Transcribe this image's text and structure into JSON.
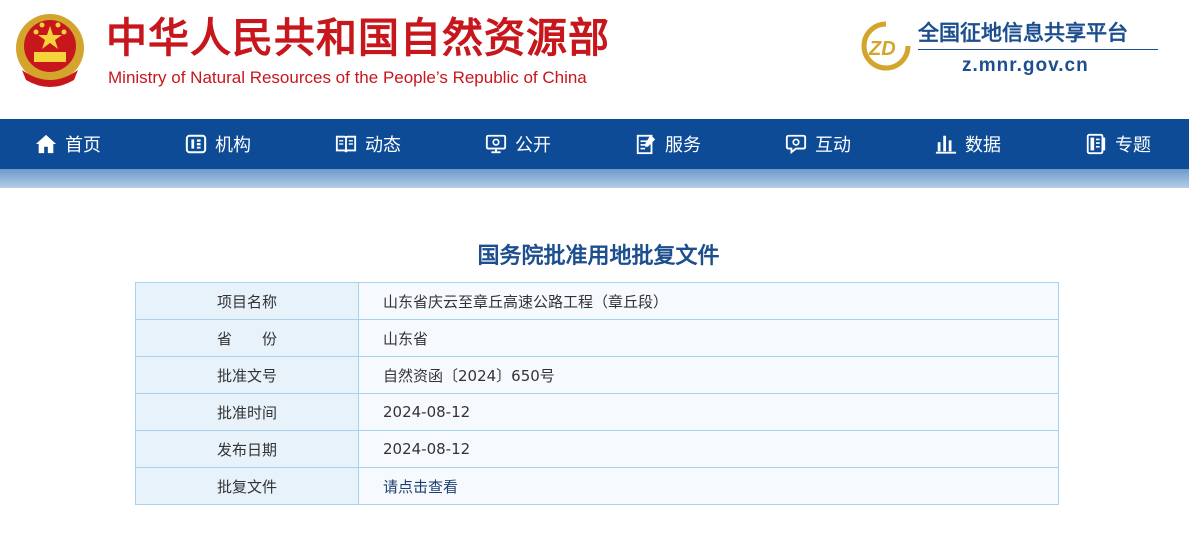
{
  "header": {
    "title_cn": "中华人民共和国自然资源部",
    "title_en": "Ministry of Natural Resources of the People’s Republic of China",
    "emblem_icon": "national-emblem-icon",
    "platform": {
      "logo_text": "ZD",
      "name": "全国征地信息共享平台",
      "url": "z.mnr.gov.cn"
    }
  },
  "nav": {
    "items": [
      {
        "label": "首页",
        "icon": "home-icon"
      },
      {
        "label": "机构",
        "icon": "organization-icon"
      },
      {
        "label": "动态",
        "icon": "book-icon"
      },
      {
        "label": "公开",
        "icon": "monitor-icon"
      },
      {
        "label": "服务",
        "icon": "edit-document-icon"
      },
      {
        "label": "互动",
        "icon": "chat-icon"
      },
      {
        "label": "数据",
        "icon": "bar-chart-icon"
      },
      {
        "label": "专题",
        "icon": "folder-icon"
      }
    ]
  },
  "main": {
    "title": "国务院批准用地批复文件",
    "rows": [
      {
        "label": "项目名称",
        "value": "山东省庆云至章丘高速公路工程（章丘段）"
      },
      {
        "label": "省　　份",
        "value": "山东省"
      },
      {
        "label": "批准文号",
        "value": "自然资函〔2024〕650号"
      },
      {
        "label": "批准时间",
        "value": "2024-08-12"
      },
      {
        "label": "发布日期",
        "value": "2024-08-12"
      },
      {
        "label": "批复文件",
        "value": "请点击查看"
      }
    ]
  },
  "colors": {
    "brand_red": "#c8161d",
    "nav_blue": "#0d4b96",
    "title_blue": "#1d4f8f",
    "table_border": "#a8d3ee"
  }
}
